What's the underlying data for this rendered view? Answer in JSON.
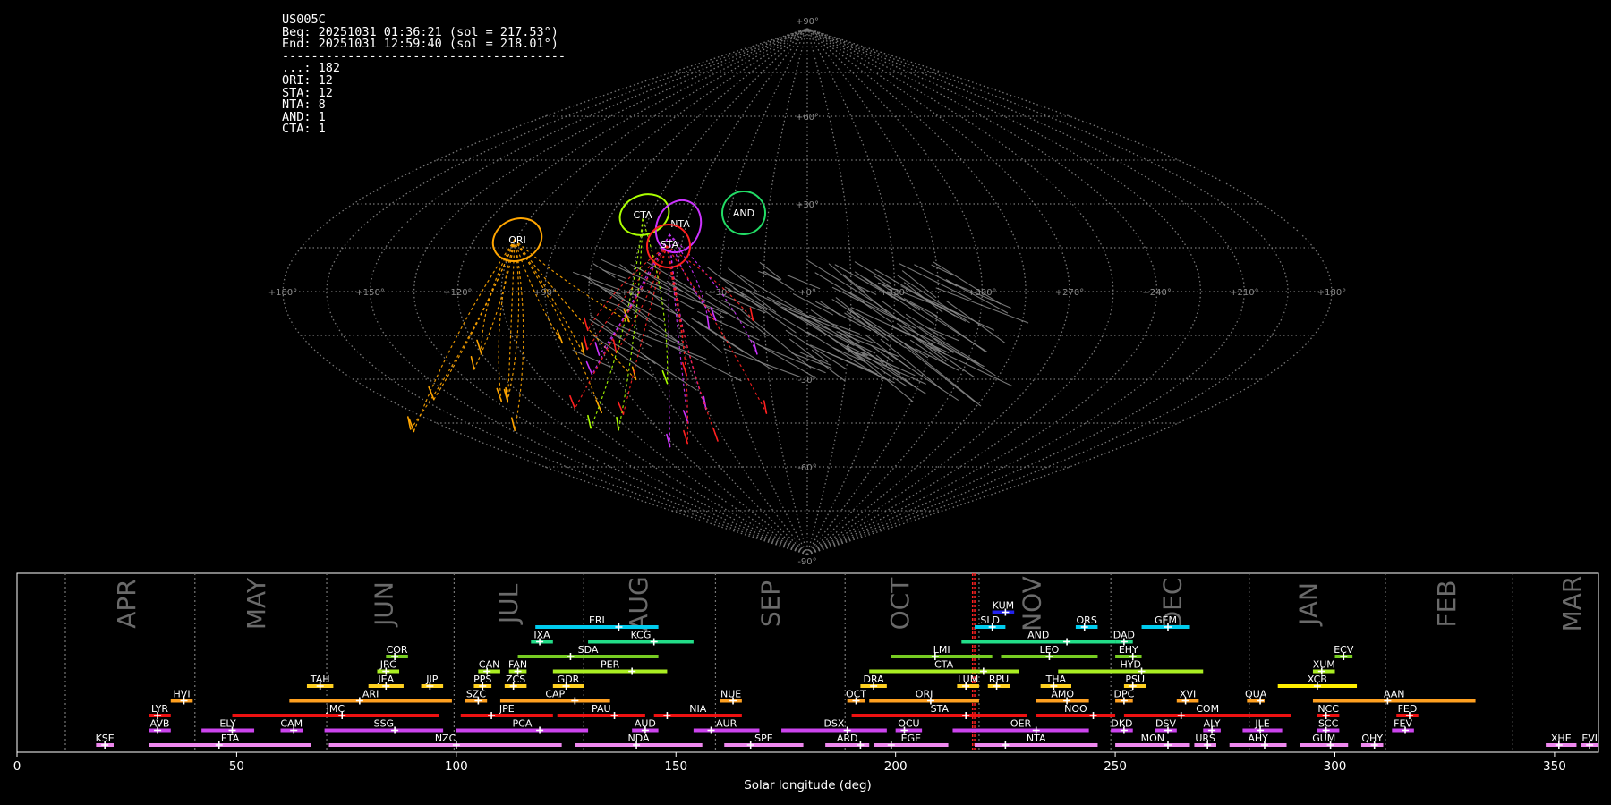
{
  "info": {
    "lines": [
      "US005C",
      "Beg: 20251031 01:36:21 (sol = 217.53°)",
      "End: 20251031 12:59:40 (sol = 218.01°)",
      "---------------------------------------",
      "...: 182",
      "ORI: 12",
      "STA: 12",
      "NTA: 8",
      "AND: 1",
      "CTA: 1"
    ]
  },
  "skymap": {
    "projection": "sinusoidal (Sanson–Flamsteed)",
    "ra_labels": [
      "+180°",
      "+150°",
      "+120°",
      "+90°",
      "+60°",
      "+30°",
      "+0°",
      "+330°",
      "+300°",
      "+270°",
      "+240°",
      "+210°",
      "+180°"
    ],
    "dec_labels": [
      "+90°",
      "+60°",
      "+30°",
      "-30°",
      "-60°",
      "-90°"
    ],
    "radiants": [
      {
        "name": "ORI",
        "color": "#ffa500"
      },
      {
        "name": "CTA",
        "color": "#aaff00"
      },
      {
        "name": "NTA",
        "color": "#cc33ff"
      },
      {
        "name": "STA",
        "color": "#ff2020"
      },
      {
        "name": "AND",
        "color": "#22dd66"
      }
    ]
  },
  "chart_data": {
    "type": "timeline",
    "xlabel": "Solar longitude (deg)",
    "xlim": [
      0,
      360
    ],
    "xticks": [
      0,
      50,
      100,
      150,
      200,
      250,
      300,
      350
    ],
    "current_sol": [
      217.53,
      218.01
    ],
    "month_boundaries": [
      11,
      40.5,
      70.5,
      99.5,
      129,
      159,
      188.5,
      219,
      249,
      280.5,
      311.5,
      340.5
    ],
    "months": [
      {
        "label": "APR",
        "x": 25
      },
      {
        "label": "MAY",
        "x": 54.5
      },
      {
        "label": "JUN",
        "x": 83.5
      },
      {
        "label": "JUL",
        "x": 112
      },
      {
        "label": "AUG",
        "x": 141.5
      },
      {
        "label": "SEP",
        "x": 171.5
      },
      {
        "label": "OCT",
        "x": 201
      },
      {
        "label": "NOV",
        "x": 231
      },
      {
        "label": "DEC",
        "x": 263
      },
      {
        "label": "JAN",
        "x": 294
      },
      {
        "label": "FEB",
        "x": 325.5
      },
      {
        "label": "MAR",
        "x": 354
      }
    ],
    "showers": [
      {
        "name": "KSE",
        "start": 18,
        "end": 22,
        "peak": 20,
        "row": 0,
        "color": "#ee88ee"
      },
      {
        "name": "ETA",
        "start": 30,
        "end": 67,
        "peak": 46,
        "row": 0,
        "color": "#ee88ee"
      },
      {
        "name": "NZC",
        "start": 71,
        "end": 124,
        "peak": 100,
        "row": 0,
        "color": "#ee88ee"
      },
      {
        "name": "NDA",
        "start": 127,
        "end": 156,
        "peak": 141,
        "row": 0,
        "color": "#ee88ee"
      },
      {
        "name": "SPE",
        "start": 161,
        "end": 179,
        "peak": 167,
        "row": 0,
        "color": "#ee88ee"
      },
      {
        "name": "ARD",
        "start": 184,
        "end": 194,
        "peak": 192,
        "row": 0,
        "color": "#ee88ee"
      },
      {
        "name": "EGE",
        "start": 195,
        "end": 212,
        "peak": 199,
        "row": 0,
        "color": "#ee88ee"
      },
      {
        "name": "NTA",
        "start": 218,
        "end": 246,
        "peak": 225,
        "row": 0,
        "color": "#ee88ee"
      },
      {
        "name": "MON",
        "start": 250,
        "end": 267,
        "peak": 262,
        "row": 0,
        "color": "#ee88ee"
      },
      {
        "name": "URS",
        "start": 268,
        "end": 273,
        "peak": 271,
        "row": 0,
        "color": "#ee88ee"
      },
      {
        "name": "AHY",
        "start": 276,
        "end": 289,
        "peak": 284,
        "row": 0,
        "color": "#ee88ee"
      },
      {
        "name": "GUM",
        "start": 292,
        "end": 303,
        "peak": 299,
        "row": 0,
        "color": "#ee88ee"
      },
      {
        "name": "QHY",
        "start": 306,
        "end": 311,
        "peak": 309,
        "row": 0,
        "color": "#ee88ee"
      },
      {
        "name": "XHE",
        "start": 348,
        "end": 355,
        "peak": 351,
        "row": 0,
        "color": "#ee88ee"
      },
      {
        "name": "EVI",
        "start": 356,
        "end": 360,
        "peak": 358,
        "row": 0,
        "color": "#ee88ee"
      },
      {
        "name": "AVB",
        "start": 30,
        "end": 35,
        "peak": 32,
        "row": 1,
        "color": "#cc44ee"
      },
      {
        "name": "ELY",
        "start": 42,
        "end": 54,
        "peak": 49,
        "row": 1,
        "color": "#cc44ee"
      },
      {
        "name": "CAM",
        "start": 60,
        "end": 65,
        "peak": 63,
        "row": 1,
        "color": "#cc44ee"
      },
      {
        "name": "SSG",
        "start": 70,
        "end": 97,
        "peak": 86,
        "row": 1,
        "color": "#cc44ee"
      },
      {
        "name": "PCA",
        "start": 100,
        "end": 130,
        "peak": 119,
        "row": 1,
        "color": "#cc44ee"
      },
      {
        "name": "AUD",
        "start": 140,
        "end": 146,
        "peak": 143,
        "row": 1,
        "color": "#cc44ee"
      },
      {
        "name": "AUR",
        "start": 154,
        "end": 169,
        "peak": 158,
        "row": 1,
        "color": "#cc44ee"
      },
      {
        "name": "DSX",
        "start": 174,
        "end": 198,
        "peak": 189,
        "row": 1,
        "color": "#cc44ee"
      },
      {
        "name": "OCU",
        "start": 200,
        "end": 206,
        "peak": 202,
        "row": 1,
        "color": "#cc44ee"
      },
      {
        "name": "OER",
        "start": 213,
        "end": 244,
        "peak": 232,
        "row": 1,
        "color": "#cc44ee"
      },
      {
        "name": "DKD",
        "start": 249,
        "end": 254,
        "peak": 252,
        "row": 1,
        "color": "#cc44ee"
      },
      {
        "name": "DSV",
        "start": 259,
        "end": 264,
        "peak": 262,
        "row": 1,
        "color": "#cc44ee"
      },
      {
        "name": "ALY",
        "start": 270,
        "end": 274,
        "peak": 272,
        "row": 1,
        "color": "#cc44ee"
      },
      {
        "name": "JLE",
        "start": 279,
        "end": 288,
        "peak": 283,
        "row": 1,
        "color": "#cc44ee"
      },
      {
        "name": "SCC",
        "start": 296,
        "end": 301,
        "peak": 298,
        "row": 1,
        "color": "#cc44ee"
      },
      {
        "name": "FEV",
        "start": 313,
        "end": 318,
        "peak": 316,
        "row": 1,
        "color": "#cc44ee"
      },
      {
        "name": "LYR",
        "start": 30,
        "end": 35,
        "peak": 32,
        "row": 2,
        "color": "#ee1111"
      },
      {
        "name": "JMC",
        "start": 49,
        "end": 96,
        "peak": 74,
        "row": 2,
        "color": "#ee1111"
      },
      {
        "name": "JPE",
        "start": 101,
        "end": 122,
        "peak": 108,
        "row": 2,
        "color": "#ee1111"
      },
      {
        "name": "PAU",
        "start": 123,
        "end": 143,
        "peak": 136,
        "row": 2,
        "color": "#ee1111"
      },
      {
        "name": "NIA",
        "start": 145,
        "end": 165,
        "peak": 148,
        "row": 2,
        "color": "#ee1111"
      },
      {
        "name": "STA",
        "start": 190,
        "end": 230,
        "peak": 216,
        "row": 2,
        "color": "#ee1111"
      },
      {
        "name": "NOO",
        "start": 232,
        "end": 250,
        "peak": 245,
        "row": 2,
        "color": "#ee1111"
      },
      {
        "name": "COM",
        "start": 252,
        "end": 290,
        "peak": 265,
        "row": 2,
        "color": "#ee1111"
      },
      {
        "name": "NCC",
        "start": 296,
        "end": 301,
        "peak": 298,
        "row": 2,
        "color": "#ee1111"
      },
      {
        "name": "FED",
        "start": 314,
        "end": 319,
        "peak": 317,
        "row": 2,
        "color": "#ee1111"
      },
      {
        "name": "HVI",
        "start": 35,
        "end": 40,
        "peak": 38,
        "row": 3,
        "color": "#ffa020"
      },
      {
        "name": "ARI",
        "start": 62,
        "end": 99,
        "peak": 78,
        "row": 3,
        "color": "#ffa020"
      },
      {
        "name": "SZC",
        "start": 102,
        "end": 107,
        "peak": 105,
        "row": 3,
        "color": "#ffa020"
      },
      {
        "name": "CAP",
        "start": 110,
        "end": 135,
        "peak": 127,
        "row": 3,
        "color": "#ffa020"
      },
      {
        "name": "NUE",
        "start": 160,
        "end": 165,
        "peak": 163,
        "row": 3,
        "color": "#ffa020"
      },
      {
        "name": "OCT",
        "start": 189,
        "end": 193,
        "peak": 191,
        "row": 3,
        "color": "#ffa020"
      },
      {
        "name": "ORI",
        "start": 194,
        "end": 219,
        "peak": 208,
        "row": 3,
        "color": "#ffa020"
      },
      {
        "name": "AMO",
        "start": 232,
        "end": 244,
        "peak": 239,
        "row": 3,
        "color": "#ffa020"
      },
      {
        "name": "DPC",
        "start": 250,
        "end": 254,
        "peak": 252,
        "row": 3,
        "color": "#ffa020"
      },
      {
        "name": "XVI",
        "start": 264,
        "end": 269,
        "peak": 266,
        "row": 3,
        "color": "#ffa020"
      },
      {
        "name": "QUA",
        "start": 280,
        "end": 284,
        "peak": 283,
        "row": 3,
        "color": "#ffa020"
      },
      {
        "name": "AAN",
        "start": 295,
        "end": 332,
        "peak": 312,
        "row": 3,
        "color": "#ffa020"
      },
      {
        "name": "TAH",
        "start": 66,
        "end": 72,
        "peak": 69,
        "row": 4,
        "color": "#ffd020"
      },
      {
        "name": "JEA",
        "start": 80,
        "end": 88,
        "peak": 84,
        "row": 4,
        "color": "#ffd020"
      },
      {
        "name": "JIP",
        "start": 92,
        "end": 97,
        "peak": 94,
        "row": 4,
        "color": "#ffd020"
      },
      {
        "name": "PPS",
        "start": 104,
        "end": 108,
        "peak": 106,
        "row": 4,
        "color": "#ffd020"
      },
      {
        "name": "ZCS",
        "start": 111,
        "end": 116,
        "peak": 113,
        "row": 4,
        "color": "#ffd020"
      },
      {
        "name": "GDR",
        "start": 122,
        "end": 129,
        "peak": 125,
        "row": 4,
        "color": "#ffd020"
      },
      {
        "name": "DRA",
        "start": 192,
        "end": 198,
        "peak": 195,
        "row": 4,
        "color": "#ffd020"
      },
      {
        "name": "LUM",
        "start": 214,
        "end": 219,
        "peak": 216,
        "row": 4,
        "color": "#ffd020"
      },
      {
        "name": "RPU",
        "start": 221,
        "end": 226,
        "peak": 223,
        "row": 4,
        "color": "#ffd020"
      },
      {
        "name": "THA",
        "start": 233,
        "end": 240,
        "peak": 236,
        "row": 4,
        "color": "#ffd020"
      },
      {
        "name": "PSU",
        "start": 252,
        "end": 257,
        "peak": 254,
        "row": 4,
        "color": "#ffd020"
      },
      {
        "name": "XCB",
        "start": 287,
        "end": 305,
        "peak": 296,
        "row": 4,
        "color": "#ffee00"
      },
      {
        "name": "JRC",
        "start": 82,
        "end": 87,
        "peak": 84,
        "row": 5,
        "color": "#aaee22"
      },
      {
        "name": "CAN",
        "start": 105,
        "end": 110,
        "peak": 107,
        "row": 5,
        "color": "#aaee22"
      },
      {
        "name": "FAN",
        "start": 112,
        "end": 116,
        "peak": 114,
        "row": 5,
        "color": "#aaee22"
      },
      {
        "name": "PER",
        "start": 122,
        "end": 148,
        "peak": 140,
        "row": 5,
        "color": "#aaee22"
      },
      {
        "name": "CTA",
        "start": 194,
        "end": 228,
        "peak": 220,
        "row": 5,
        "color": "#aaee22"
      },
      {
        "name": "HYD",
        "start": 237,
        "end": 270,
        "peak": 256,
        "row": 5,
        "color": "#aaee22"
      },
      {
        "name": "XUM",
        "start": 295,
        "end": 300,
        "peak": 297,
        "row": 5,
        "color": "#aaee22"
      },
      {
        "name": "COR",
        "start": 84,
        "end": 89,
        "peak": 86,
        "row": 6,
        "color": "#77cc22"
      },
      {
        "name": "SDA",
        "start": 114,
        "end": 146,
        "peak": 126,
        "row": 6,
        "color": "#77cc22"
      },
      {
        "name": "LMI",
        "start": 199,
        "end": 222,
        "peak": 209,
        "row": 6,
        "color": "#77cc22"
      },
      {
        "name": "LEO",
        "start": 224,
        "end": 246,
        "peak": 235,
        "row": 6,
        "color": "#77cc22"
      },
      {
        "name": "EHY",
        "start": 250,
        "end": 256,
        "peak": 254,
        "row": 6,
        "color": "#77cc22"
      },
      {
        "name": "ECV",
        "start": 300,
        "end": 304,
        "peak": 302,
        "row": 6,
        "color": "#77cc22"
      },
      {
        "name": "IXA",
        "start": 117,
        "end": 122,
        "peak": 119,
        "row": 7,
        "color": "#22dd88"
      },
      {
        "name": "KCG",
        "start": 130,
        "end": 154,
        "peak": 145,
        "row": 7,
        "color": "#22dd88"
      },
      {
        "name": "AND",
        "start": 215,
        "end": 250,
        "peak": 239,
        "row": 7,
        "color": "#22dd88"
      },
      {
        "name": "DAD",
        "start": 250,
        "end": 254,
        "peak": 252,
        "row": 7,
        "color": "#22dd88"
      },
      {
        "name": "ERI",
        "start": 118,
        "end": 146,
        "peak": 137,
        "row": 8,
        "color": "#00ccee"
      },
      {
        "name": "SLD",
        "start": 218,
        "end": 225,
        "peak": 222,
        "row": 8,
        "color": "#00ccee"
      },
      {
        "name": "ORS",
        "start": 241,
        "end": 246,
        "peak": 243,
        "row": 8,
        "color": "#00ccee"
      },
      {
        "name": "GEM",
        "start": 256,
        "end": 267,
        "peak": 262,
        "row": 8,
        "color": "#00ccee"
      },
      {
        "name": "KUM",
        "start": 222,
        "end": 227,
        "peak": 225,
        "row": 9,
        "color": "#2222ee"
      }
    ]
  }
}
